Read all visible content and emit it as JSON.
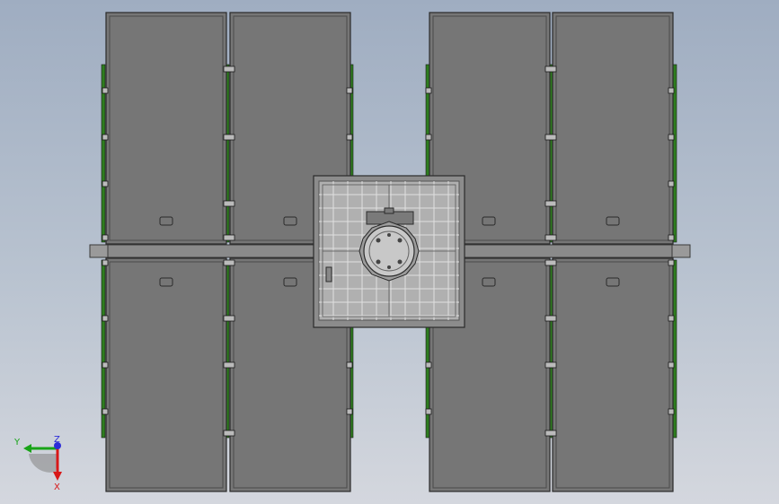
{
  "viewport": {
    "background_top": "#9fadc1",
    "background_bottom": "#d4d7de",
    "panel_fill": "#767676",
    "panel_edge": "#2b2b2b",
    "hinge_color": "#2e7d1f",
    "rail_color": "#8a8a8a",
    "hub_fill": "#b8b8b8",
    "grid_color": "#d8d8d8"
  },
  "triad": {
    "y_label": "Y",
    "z_label": "Z",
    "x_label": "X",
    "y_color": "#18a418",
    "z_color": "#2b2bd8",
    "x_color": "#d81818"
  }
}
